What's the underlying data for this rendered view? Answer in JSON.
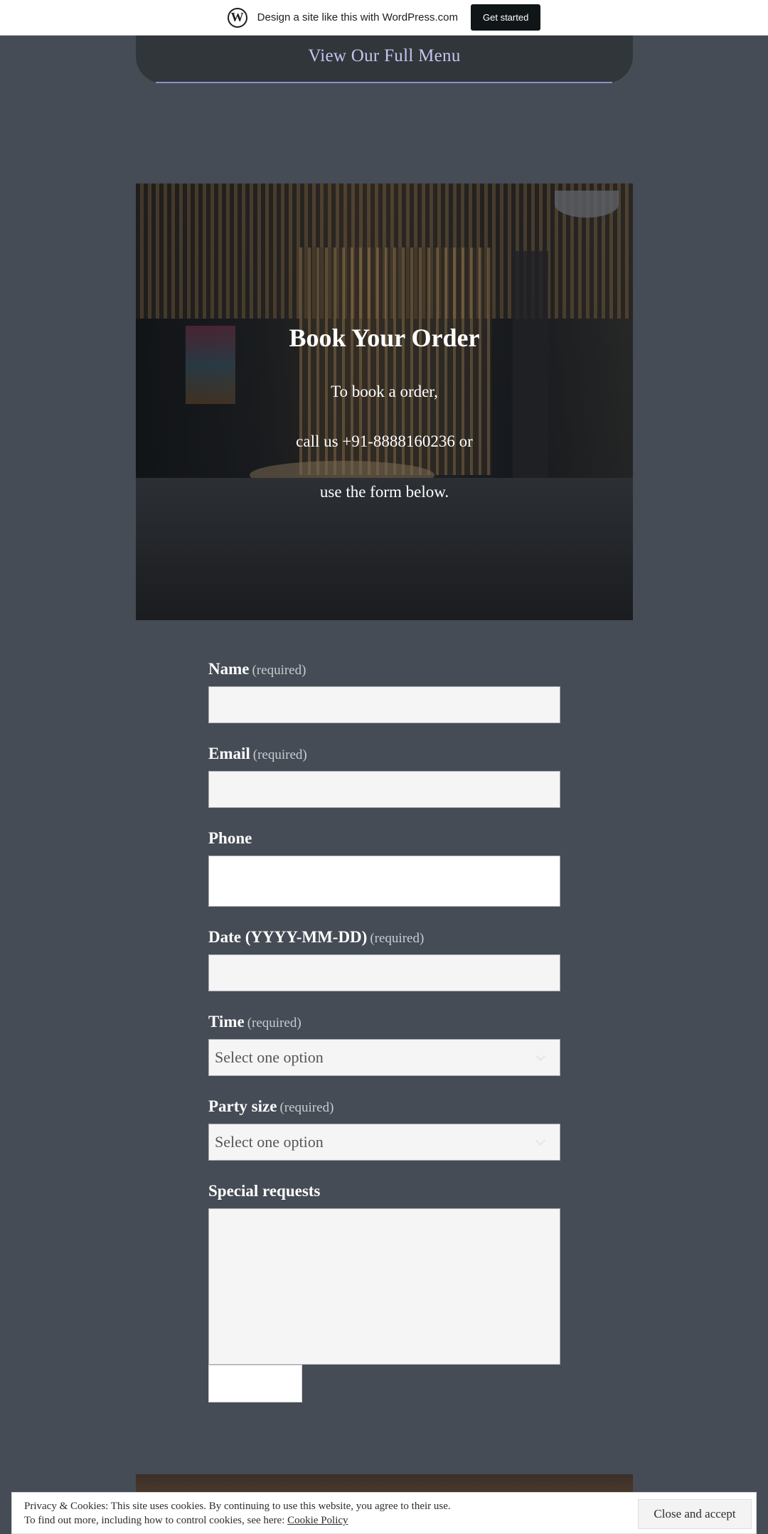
{
  "wpbar": {
    "logo": "W",
    "text": "Design a site like this with WordPress.com",
    "cta": "Get started"
  },
  "menu": {
    "label": "View Our Full Menu"
  },
  "hero": {
    "title": "Book Your Order",
    "line1": "To book a order,",
    "line2": "call us +91-8888160236 or",
    "line3": "use the form below."
  },
  "form": {
    "required_text": "(required)",
    "name_label": "Name",
    "email_label": "Email",
    "phone_label": "Phone",
    "date_label": "Date (YYYY-MM-DD)",
    "time_label": "Time",
    "time_value": "Select one option",
    "party_label": "Party size",
    "party_value": "Select one option",
    "requests_label": "Special requests"
  },
  "cookie": {
    "line1": "Privacy & Cookies: This site uses cookies. By continuing to use this website, you agree to their use.",
    "line2": "To find out more, including how to control cookies, see here:",
    "link": "Cookie Policy",
    "button": "Close and accept"
  },
  "colors": {
    "background": "#454c55",
    "menu_button": "#31363b",
    "menu_text": "#c6c4ef",
    "input_bg": "#f5f5f5"
  }
}
